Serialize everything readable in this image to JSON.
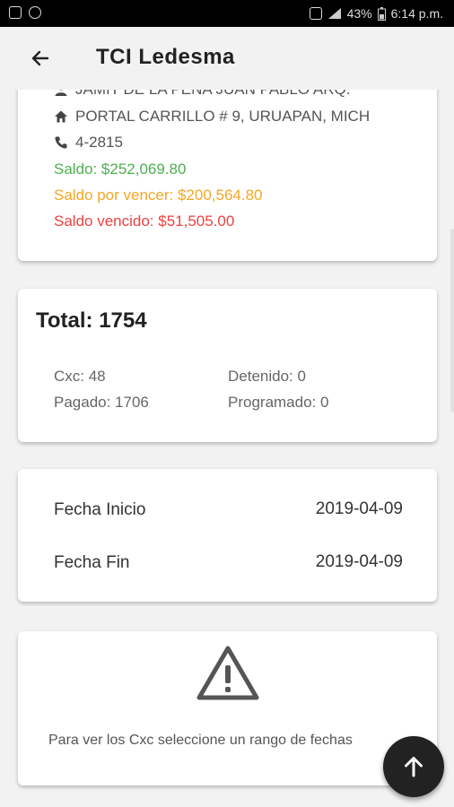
{
  "status_bar": {
    "battery": "43%",
    "time": "6:14 p.m."
  },
  "app_bar": {
    "title": "TCI Ledesma"
  },
  "client_card": {
    "contact": "JAMIT DE LA PEÑA JUAN PABLO ARQ.",
    "address": "PORTAL CARRILLO # 9, URUAPAN, MICH",
    "phone": "4-2815",
    "saldo": "Saldo: $252,069.80",
    "saldo_por_vencer": "Saldo por vencer: $200,564.80",
    "saldo_vencido": "Saldo vencido: $51,505.00"
  },
  "totals_card": {
    "total": "Total: 1754",
    "cxc": "Cxc: 48",
    "pagado": "Pagado: 1706",
    "detenido": "Detenido: 0",
    "programado": "Programado: 0"
  },
  "dates_card": {
    "inicio_label": "Fecha Inicio",
    "inicio_value": "2019-04-09",
    "fin_label": "Fecha Fin",
    "fin_value": "2019-04-09"
  },
  "empty_card": {
    "icon": "warning-icon",
    "message": "Para ver los Cxc seleccione un rango de fechas"
  },
  "fab": {
    "icon": "arrow-up-icon"
  },
  "colors": {
    "saldo": "#4caf50",
    "por_vencer": "#f5a623",
    "vencido": "#f04040",
    "fab": "#222222"
  }
}
